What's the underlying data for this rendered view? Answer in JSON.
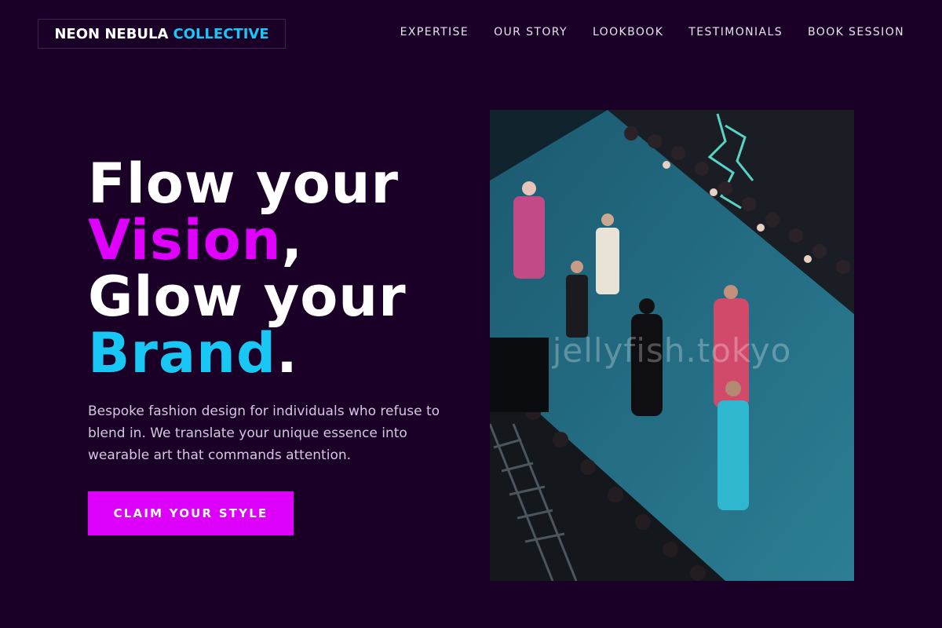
{
  "brand": {
    "name_primary": "NEON NEBULA",
    "name_accent": "COLLECTIVE"
  },
  "nav": {
    "items": [
      {
        "label": "EXPERTISE"
      },
      {
        "label": "OUR STORY"
      },
      {
        "label": "LOOKBOOK"
      },
      {
        "label": "TESTIMONIALS"
      },
      {
        "label": "BOOK SESSION"
      }
    ]
  },
  "hero": {
    "line1": "Flow your",
    "word_vision": "Vision",
    "punct_comma": ",",
    "line3": "Glow your",
    "word_brand": "Brand",
    "punct_period": ".",
    "subtext": "Bespoke fashion design for individuals who refuse to blend in. We translate your unique essence into wearable art that commands attention.",
    "cta_label": "CLAIM YOUR STYLE"
  },
  "photo": {
    "watermark": "jellyfish.tokyo"
  },
  "colors": {
    "background": "#1a0026",
    "accent_magenta": "#e000ff",
    "accent_cyan": "#19c7f5",
    "cta_background": "#dd00fb"
  }
}
